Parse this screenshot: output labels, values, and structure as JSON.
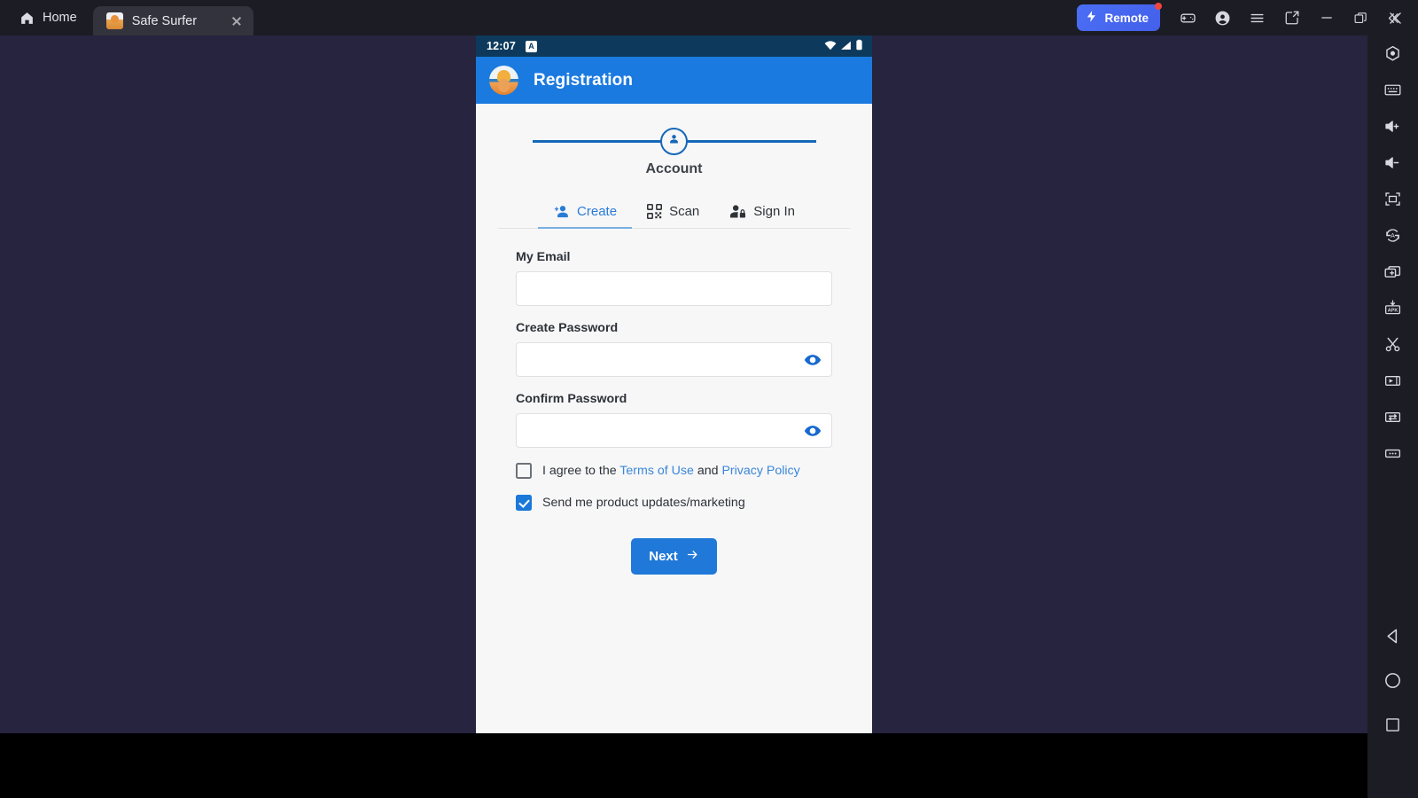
{
  "window": {
    "home_tab_label": "Home",
    "browser_tab_label": "Safe Surfer",
    "remote_label": "Remote",
    "titlebar_icons": [
      {
        "name": "gamepad-icon"
      },
      {
        "name": "account-icon"
      },
      {
        "name": "menu-icon"
      },
      {
        "name": "screenshot-icon"
      },
      {
        "name": "minimize-icon"
      },
      {
        "name": "maximize-icon"
      },
      {
        "name": "close-icon"
      }
    ],
    "collapse_icon": "chevron-double-left-icon"
  },
  "rail": {
    "items": [
      {
        "name": "location-icon"
      },
      {
        "name": "keyboard-icon"
      },
      {
        "name": "volume-up-icon"
      },
      {
        "name": "volume-down-icon"
      },
      {
        "name": "fullscreen-icon"
      },
      {
        "name": "auto-rotate-icon"
      },
      {
        "name": "multi-instance-icon"
      },
      {
        "name": "install-apk-icon",
        "label": "APK"
      },
      {
        "name": "scissors-icon"
      },
      {
        "name": "media-icon"
      },
      {
        "name": "file-transfer-icon"
      },
      {
        "name": "more-options-icon"
      }
    ],
    "nav": [
      {
        "name": "android-back-button"
      },
      {
        "name": "android-home-button"
      },
      {
        "name": "android-recents-button"
      }
    ]
  },
  "phone": {
    "statusbar": {
      "time": "12:07",
      "app_badge": "A",
      "icons": [
        "wifi-icon",
        "signal-icon",
        "battery-icon"
      ]
    },
    "appbar": {
      "title": "Registration",
      "logo": "safe-surfer-logo"
    },
    "stepper": {
      "label": "Account",
      "icon": "account-circle-icon"
    },
    "tabs": [
      {
        "label": "Create",
        "icon": "person-add-icon",
        "active": true
      },
      {
        "label": "Scan",
        "icon": "qr-code-icon",
        "active": false
      },
      {
        "label": "Sign In",
        "icon": "person-lock-icon",
        "active": false
      }
    ],
    "form": {
      "email": {
        "label": "My Email",
        "value": "",
        "placeholder": ""
      },
      "password": {
        "label": "Create Password",
        "value": "",
        "placeholder": "",
        "toggle_icon": "eye-icon"
      },
      "confirm_password": {
        "label": "Confirm Password",
        "value": "",
        "placeholder": "",
        "toggle_icon": "eye-icon"
      },
      "terms": {
        "checked": false,
        "text_before": "I agree to the ",
        "link1": "Terms of Use",
        "text_between": " and ",
        "link2": "Privacy Policy"
      },
      "marketing": {
        "checked": true,
        "text": "Send me product updates/marketing"
      },
      "submit": {
        "label": "Next",
        "icon": "arrow-right-icon"
      }
    }
  },
  "colors": {
    "accent_blue": "#1b7ae0",
    "link_blue": "#3a87d8",
    "button_blue": "#2079d8",
    "statusbar": "#0d3a5c",
    "backdrop": "#26243f",
    "chrome": "#1c1c24",
    "remote": "#4b6ef5",
    "badge_red": "#f2453d"
  }
}
